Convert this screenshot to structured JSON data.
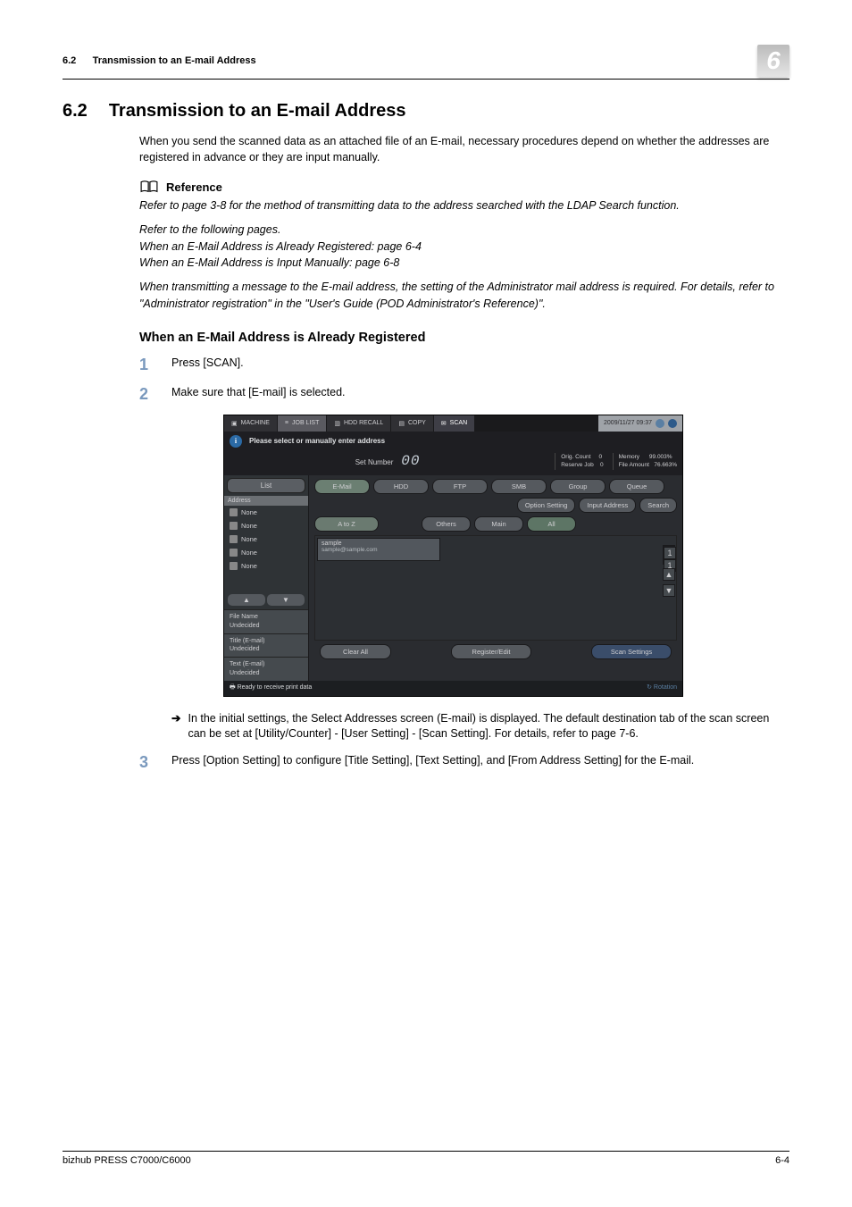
{
  "header": {
    "left_section_num": "6.2",
    "left_section_title": "Transmission to an E-mail Address",
    "chapter_badge": "6"
  },
  "section": {
    "num": "6.2",
    "title": "Transmission to an E-mail Address",
    "intro": "When you send the scanned data as an attached file of an E-mail, necessary procedures depend on whether the addresses are registered in advance or they are input manually."
  },
  "reference": {
    "heading": "Reference",
    "p1": "Refer to page 3-8 for the method of transmitting data to the address searched with the LDAP Search function.",
    "p2": "Refer to the following pages.",
    "p3": "When an E-Mail Address is Already Registered: page 6-4",
    "p4": "When an E-Mail Address is Input Manually: page 6-8",
    "p5": "When transmitting a message to the E-mail address, the setting of the Administrator mail address is required. For details, refer to \"Administrator registration\" in the \"User's Guide (POD Administrator's Reference)\"."
  },
  "subheading": "When an E-Mail Address is Already Registered",
  "steps": {
    "s1": {
      "num": "1",
      "text": "Press [SCAN]."
    },
    "s2": {
      "num": "2",
      "text": "Make sure that [E-mail] is selected.",
      "note": "In the initial settings, the Select Addresses screen (E-mail) is displayed.  The default destination tab of the scan screen can be set at [Utility/Counter] - [User Setting] - [Scan Setting]. For details, refer to page 7-6."
    },
    "s3": {
      "num": "3",
      "text": "Press [Option Setting] to configure [Title Setting], [Text Setting], and [From Address Setting] for the E-mail."
    }
  },
  "screenshot": {
    "tabs": {
      "machine": "MACHINE",
      "joblist": "JOB LIST",
      "hddrecall": "HDD RECALL",
      "copy": "COPY",
      "scan": "SCAN",
      "datetime": "2009/11/27 09:37"
    },
    "info_msg": "Please select or manually enter address",
    "stats": {
      "set_number_label": "Set Number",
      "set_number_value": "00",
      "orig_count_label": "Orig. Count",
      "orig_count_value": "0",
      "reserve_job_label": "Reserve Job",
      "reserve_job_value": "0",
      "memory_label": "Memory",
      "memory_value": "99.003%",
      "file_amount_label": "File Amount",
      "file_amount_value": "76.663%"
    },
    "sidebar": {
      "list_btn": "List",
      "address_header": "Address",
      "rows": [
        "None",
        "None",
        "None",
        "None",
        "None"
      ],
      "file_name_label": "File Name",
      "file_name_value": "Undecided",
      "title_label": "Title (E-mail)",
      "title_value": "Undecided",
      "text_label": "Text (E-mail)",
      "text_value": "Undecided"
    },
    "proto_tabs": [
      "E-Mail",
      "HDD",
      "FTP",
      "SMB",
      "Group",
      "Queue"
    ],
    "action_row": [
      "Option Setting",
      "Input Address",
      "Search"
    ],
    "filter_row": [
      "A to Z",
      "Others",
      "Main",
      "All"
    ],
    "card": {
      "title": "sample",
      "sub": "sample@sample.com"
    },
    "scroll": {
      "count_top": "1",
      "count_bot": "1",
      "up": "▲",
      "down": "▼"
    },
    "bottom": {
      "clear": "Clear All",
      "register": "Register/Edit",
      "scan_settings": "Scan Settings"
    },
    "statusbar": {
      "left": "Ready to receive print data",
      "right": "Rotation"
    }
  },
  "footer": {
    "product": "bizhub PRESS C7000/C6000",
    "page": "6-4"
  }
}
